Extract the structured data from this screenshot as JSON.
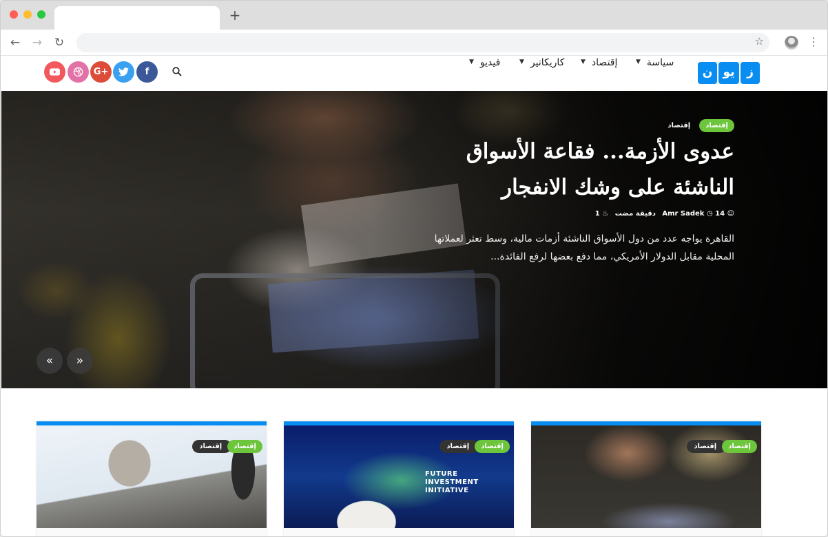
{
  "browser": {
    "address": "",
    "new_tab": "+"
  },
  "site": {
    "logo": [
      "ن",
      "يو",
      "ز"
    ],
    "menu": [
      {
        "label": "سياسة"
      },
      {
        "label": "إقتصاد"
      },
      {
        "label": "كاريكاتير"
      },
      {
        "label": "فيديو"
      }
    ],
    "social": [
      {
        "name": "facebook",
        "glyph": "f",
        "color": "#3b5998"
      },
      {
        "name": "twitter",
        "glyph": "t",
        "color": "#3aa1f2"
      },
      {
        "name": "google-plus",
        "glyph": "G+",
        "color": "#dd4b39"
      },
      {
        "name": "dribbble",
        "glyph": "◎",
        "color": "#e272a6"
      },
      {
        "name": "youtube",
        "glyph": "▶",
        "color": "#f2595e"
      }
    ]
  },
  "hero": {
    "badges": [
      "إقتصاد",
      "إقتصاد"
    ],
    "title": "عدوى الأزمة... فقاعة الأسواق الناشئة على وشك الانفجار",
    "author": "Amr Sadek",
    "time": "14 دقيقة مضت",
    "views": "1",
    "excerpt": "القاهرة يواجه عدد من دول الأسواق الناشئة أزمات مالية، وسط تعثر لعملاتها المحلية مقابل الدولار الأمريكي، مما دفع بعضها لرفع الفائدة...",
    "prev": "«",
    "next": "»"
  },
  "cards": [
    {
      "badge_primary": "إقتصاد",
      "badge_secondary": "إقتصاد"
    },
    {
      "badge_primary": "إقتصاد",
      "badge_secondary": "إقتصاد",
      "image_text": [
        "FUTURE",
        "INVESTMENT",
        "INITIATIVE"
      ]
    },
    {
      "badge_primary": "إقتصاد",
      "badge_secondary": "إقتصاد"
    }
  ],
  "colors": {
    "brand": "#0a8df0",
    "badge_green": "#6cc53b",
    "badge_dark": "#333333"
  }
}
